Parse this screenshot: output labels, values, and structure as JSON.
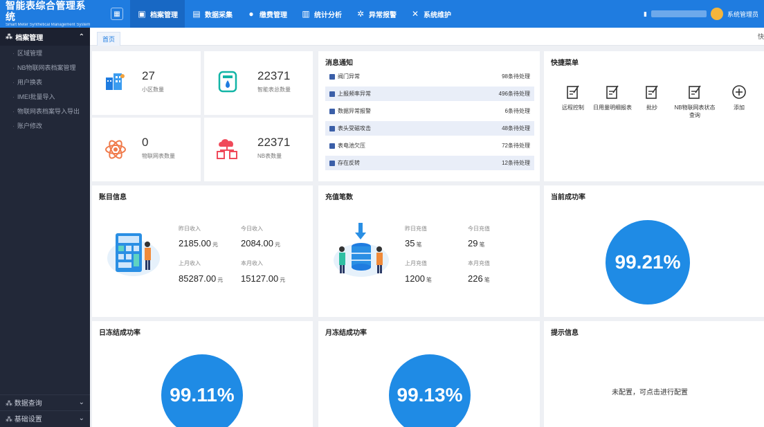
{
  "brand": {
    "title": "智能表综合管理系统",
    "subtitle": "Smart Meter Synthetical Management System"
  },
  "nav": {
    "items": [
      {
        "label": "档案管理",
        "active": true
      },
      {
        "label": "数据采集"
      },
      {
        "label": "缴费管理"
      },
      {
        "label": "统计分析"
      },
      {
        "label": "异常报警"
      },
      {
        "label": "系统维护"
      }
    ],
    "user": "系统管理员"
  },
  "sidebar": {
    "section": "档案管理",
    "items": [
      "区域管理",
      "NB物联网表档案管理",
      "用户换表",
      "IMEI批量导入",
      "物联网表档案导入导出",
      "账户修改"
    ],
    "bottom": [
      "数据查询",
      "基础设置"
    ]
  },
  "tabs": {
    "home": "首页",
    "right": "快"
  },
  "stats": [
    {
      "value": "27",
      "label": "小区数量"
    },
    {
      "value": "22371",
      "label": "智能表总数量"
    },
    {
      "value": "0",
      "label": "物联网表数量"
    },
    {
      "value": "22371",
      "label": "NB表数量"
    }
  ],
  "notice": {
    "title": "消息通知",
    "rows": [
      {
        "label": "阀门异常",
        "status": "98条待处理"
      },
      {
        "label": "上报频率异常",
        "status": "496条待处理"
      },
      {
        "label": "数据异常报警",
        "status": "6条待处理"
      },
      {
        "label": "表头受磁攻击",
        "status": "48条待处理"
      },
      {
        "label": "表电池欠压",
        "status": "72条待处理"
      },
      {
        "label": "存在反转",
        "status": "12条待处理"
      }
    ]
  },
  "quick": {
    "title": "快捷菜单",
    "items": [
      "远程控制",
      "日用量明细报表",
      "批抄",
      "NB物联网表状态查询",
      "添加"
    ]
  },
  "account": {
    "title": "账目信息",
    "yesterday_label": "昨日收入",
    "yesterday": "2185.00",
    "today_label": "今日收入",
    "today": "2084.00",
    "lastmonth_label": "上月收入",
    "lastmonth": "85287.00",
    "thismonth_label": "本月收入",
    "thismonth": "15127.00",
    "unit": "元"
  },
  "recharge": {
    "title": "充值笔数",
    "yesterday_label": "昨日充值",
    "yesterday": "35",
    "today_label": "今日充值",
    "today": "29",
    "lastmonth_label": "上月充值",
    "lastmonth": "1200",
    "thismonth_label": "本月充值",
    "thismonth": "226",
    "unit": "笔"
  },
  "success": {
    "title": "当前成功率",
    "value": "99.21%"
  },
  "daily": {
    "title": "日冻结成功率",
    "value": "99.11%"
  },
  "monthly": {
    "title": "月冻结成功率",
    "value": "99.13%"
  },
  "tips": {
    "title": "提示信息",
    "text": "未配置，可点击进行配置"
  },
  "colors": {
    "primary": "#1f7ce0",
    "sidebar": "#222838",
    "circle": "#1f8be5"
  }
}
